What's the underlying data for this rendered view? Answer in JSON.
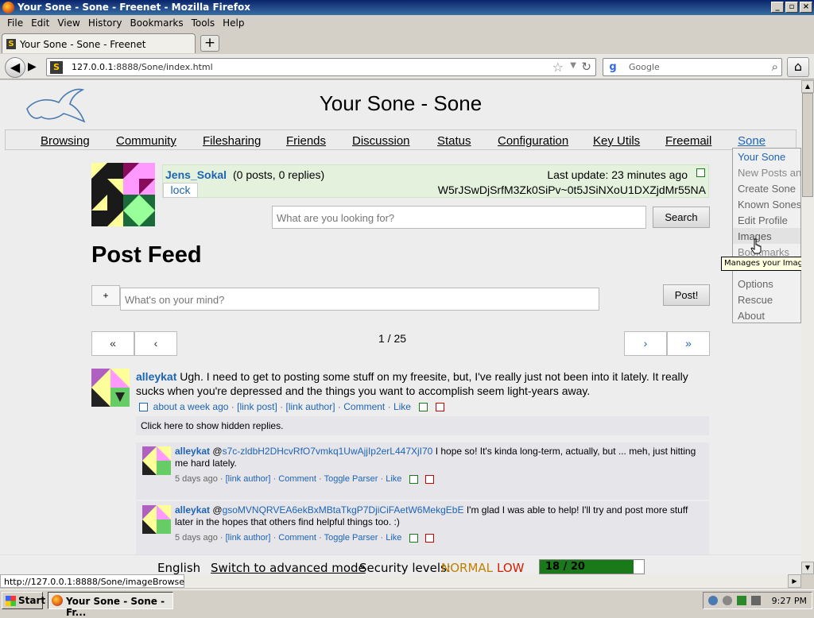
{
  "window": {
    "title": "Your Sone - Sone - Freenet - Mozilla Firefox"
  },
  "menubar": [
    "File",
    "Edit",
    "View",
    "History",
    "Bookmarks",
    "Tools",
    "Help"
  ],
  "tab": {
    "label": "Your Sone - Sone - Freenet",
    "new_tab": "+"
  },
  "urlbar": {
    "host": "127.0.0.1",
    "rest": ":8888/Sone/index.html"
  },
  "searchbar": {
    "placeholder": "Google"
  },
  "page": {
    "title": "Your Sone - Sone",
    "nav": [
      "Browsing",
      "Community",
      "Filesharing",
      "Friends",
      "Discussion",
      "Status",
      "Configuration",
      "Key Utils",
      "Freemail",
      "Sone"
    ],
    "sone": {
      "name": "Jens_Sokal",
      "counts": "(0 posts, 0 replies)",
      "last_update": "Last update: 23 minutes ago",
      "id": "W5rJSwDjSrfM3Zk0SiPv~0t5JSiNXoU1DXZjdMr55NA",
      "lock": "lock"
    },
    "search": {
      "placeholder": "What are you looking for?",
      "button": "Search"
    },
    "feed_title": "Post Feed",
    "post_form": {
      "plus": "+",
      "placeholder": "What's on your mind?",
      "button": "Post!"
    },
    "pagination": {
      "first": "«",
      "prev": "‹",
      "next": "›",
      "last": "»",
      "count": "1 / 25"
    },
    "post": {
      "author": "alleykat",
      "text": "Ugh.  I need to get to posting some stuff on my freesite, but, I've really just not been into it lately.  It really sucks when you're depressed and the things you want to accomplish seem light-years away.",
      "time": "about a week ago",
      "link_post": "[link post]",
      "link_author": "[link author]",
      "comment": "Comment",
      "like": "Like"
    },
    "hidden_replies": "Click here to show hidden replies.",
    "replies": [
      {
        "author": "alleykat",
        "mention": "@",
        "ref": "s7c-zldbH2DHcvRfO7vmkq1UwAjjIp2erL447XjI70",
        "text": "I hope so!  It's kinda long-term, actually, but ... meh, just hitting me hard lately.",
        "time": "5 days ago",
        "link_author": "[link author]",
        "comment": "Comment",
        "toggle": "Toggle Parser",
        "like": "Like"
      },
      {
        "author": "alleykat",
        "mention": "@",
        "ref": "gsoMVNQRVEA6ekBxMBtaTkgP7DjiCiFAetW6MekgEbE",
        "text": "I'm glad I was able to help!  I'll try and post more stuff later in the hopes that others find helpful things too. :)",
        "time": "5 days ago",
        "link_author": "[link author]",
        "comment": "Comment",
        "toggle": "Toggle Parser",
        "like": "Like"
      }
    ],
    "dropdown": [
      "Your Sone",
      "New Posts and Replies",
      "Create Sone",
      "Known Sones",
      "Edit Profile",
      "Images",
      "Bookmarks",
      "Options",
      "Rescue",
      "About"
    ],
    "tooltip": "Manages your Images",
    "footer": {
      "language": "English",
      "advanced": "Switch to advanced mode",
      "security": "Security levels:",
      "normal": "NORMAL",
      "low": "LOW",
      "peers": "18 / 20",
      "peers_fraction": 0.9
    }
  },
  "status_url": "http://127.0.0.1:8888/Sone/imageBrowser.html",
  "taskbar": {
    "start": "Start",
    "item": "Your Sone - Sone - Fr...",
    "clock": "9:27 PM"
  },
  "colors": {
    "link": "#1e64b4",
    "normal": "#c08000",
    "low": "#d02000",
    "bar": "#1a7a1a",
    "sone_box": "#e4f2dd"
  }
}
